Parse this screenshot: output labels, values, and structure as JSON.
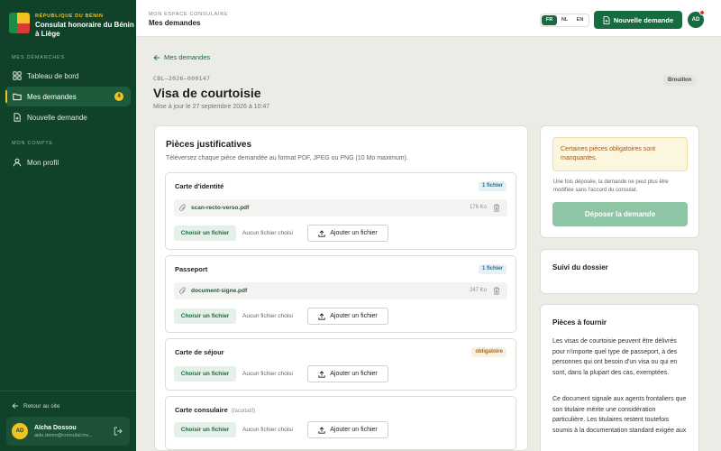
{
  "brand": {
    "kicker": "République du Bénin",
    "name": "Consulat honoraire du Bénin à Liège"
  },
  "sidebar": {
    "section_requests": "Mes démarches",
    "items": [
      {
        "label": "Tableau de bord",
        "icon": "grid-icon"
      },
      {
        "label": "Mes demandes",
        "icon": "folder-icon",
        "badge": "4",
        "active": true
      },
      {
        "label": "Nouvelle demande",
        "icon": "file-plus-icon"
      }
    ],
    "section_account": "Mon compte",
    "account_items": [
      {
        "label": "Mon profil",
        "icon": "user-icon"
      }
    ],
    "back_to_site": "Retour au site",
    "user": {
      "initials": "AD",
      "name": "Aïcha Dossou",
      "email": "aide.demo@consulat.inv..."
    }
  },
  "header": {
    "kicker": "Mon espace consulaire",
    "title": "Mes demandes",
    "languages": [
      "FR",
      "NL",
      "EN"
    ],
    "active_language": "FR",
    "new_request_label": "Nouvelle demande",
    "avatar_initials": "AD"
  },
  "request": {
    "back_label": "Mes demandes",
    "reference": "CBL–2026–000147",
    "title": "Visa de courtoisie",
    "updated": "Mise à jour le 27 septembre 2026 à 10:47",
    "status": "Brouillon"
  },
  "documents_panel": {
    "title": "Pièces justificatives",
    "subtitle": "Téléversez chaque pièce demandée au format PDF, JPEG ou PNG (10 Mo maximum).",
    "choose_label": "Choisir un fichier",
    "no_file_label": "Aucun fichier choisi",
    "add_label": "Ajouter un fichier",
    "docs": [
      {
        "name": "Carte d'identité",
        "optional": "",
        "tag": "1 fichier",
        "file": {
          "name": "scan-recto-verso.pdf",
          "size": "176 Ko"
        }
      },
      {
        "name": "Passeport",
        "optional": "",
        "tag": "1 fichier",
        "file": {
          "name": "document-signe.pdf",
          "size": "247 Ko"
        }
      },
      {
        "name": "Carte de séjour",
        "optional": "",
        "tag": "obligatoire"
      },
      {
        "name": "Carte consulaire",
        "optional": "(facultatif)",
        "tag": ""
      }
    ]
  },
  "submit_card": {
    "alert": "Certaines pièces obligatoires sont manquantes.",
    "note": "Une fois déposée, la demande ne peut plus être modifiée sans l'accord du consulat.",
    "submit_label": "Déposer la demande"
  },
  "tracking_card": {
    "title": "Suivi du dossier"
  },
  "required_card": {
    "title": "Pièces à fournir",
    "paragraph1": "Les visas de courtoisie peuvent être délivrés pour n'importe quel type de passeport, à des personnes qui ont besoin d'un visa ou qui en sont, dans la plupart des cas, exemptées.",
    "paragraph2": "Ce document signale aux agents frontaliers que son titulaire mérite une considération particulière. Les titulaires restent toutefois soumis à la documentation standard exigée aux"
  },
  "colors": {
    "sidebar": "#10422a",
    "primary": "#176b41",
    "accent": "#f2c320",
    "warning": "#a0591e"
  }
}
